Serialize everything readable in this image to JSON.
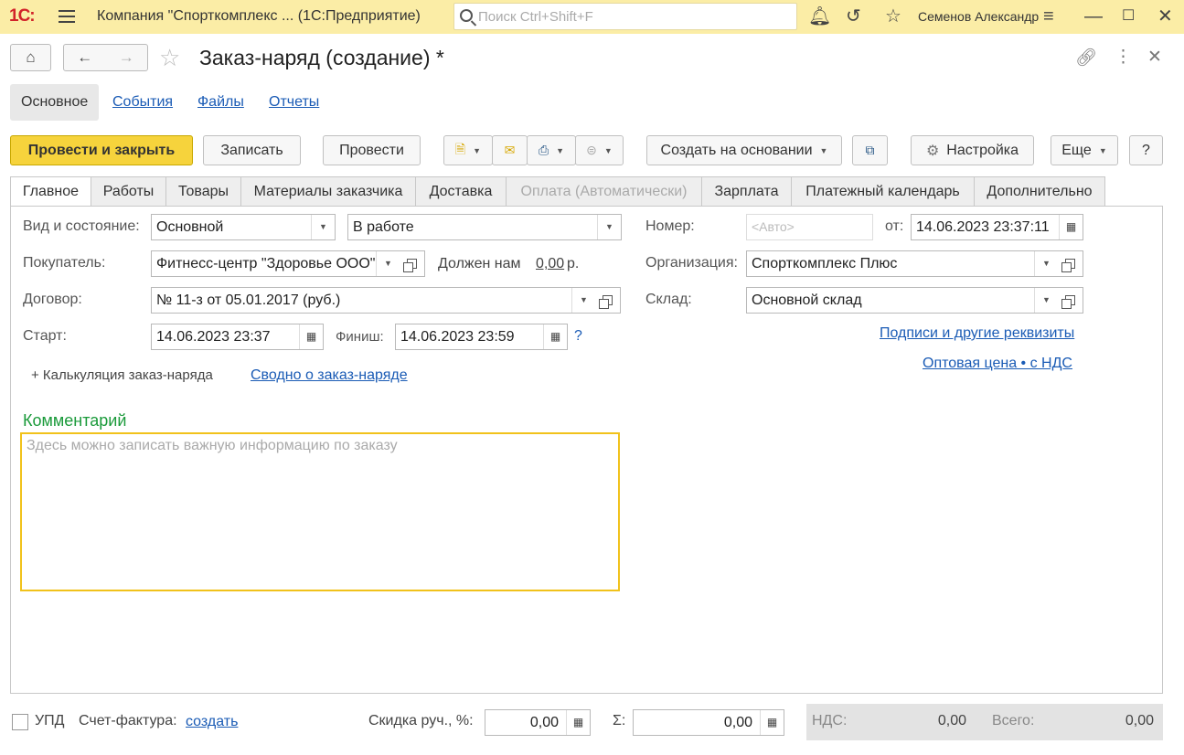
{
  "topbar": {
    "logo": "1С:",
    "app_title": "Компания \"Спорткомплекс ...   (1С:Предприятие)",
    "search_placeholder": "Поиск Ctrl+Shift+F",
    "user": "Семенов Александр"
  },
  "header": {
    "title": "Заказ-наряд (создание) *"
  },
  "nav": {
    "tabs": [
      "Основное",
      "События",
      "Файлы",
      "Отчеты"
    ]
  },
  "toolbar": {
    "post_close": "Провести и закрыть",
    "save": "Записать",
    "post": "Провести",
    "create_based": "Создать на основании",
    "settings": "Настройка",
    "more": "Еще",
    "help": "?"
  },
  "tabs": [
    "Главное",
    "Работы",
    "Товары",
    "Материалы заказчика",
    "Доставка",
    "Оплата (Автоматически)",
    "Зарплата",
    "Платежный календарь",
    "Дополнительно"
  ],
  "form": {
    "kind_label": "Вид и состояние:",
    "kind_value": "Основной",
    "state_value": "В работе",
    "buyer_label": "Покупатель:",
    "buyer_value": "Фитнесс-центр \"Здоровье ООО\"",
    "owes_label": "Должен нам",
    "owes_value": "0,00",
    "owes_unit": "р.",
    "contract_label": "Договор:",
    "contract_value": "№ 11-з от 05.01.2017 (руб.)",
    "start_label": "Старт:",
    "start_value": "14.06.2023 23:37",
    "finish_label": "Финиш:",
    "finish_value": "14.06.2023 23:59",
    "help_q": "?",
    "calc_label": "+ Калькуляция заказ-наряда",
    "summary_link": "Сводно о заказ-наряде",
    "number_label": "Номер:",
    "number_placeholder": "<Авто>",
    "date_label": "от:",
    "date_value": "14.06.2023 23:37:11",
    "org_label": "Организация:",
    "org_value": "Спорткомплекс Плюс",
    "warehouse_label": "Склад:",
    "warehouse_value": "Основной склад",
    "signatures_link": "Подписи и другие реквизиты",
    "price_link": "Оптовая цена • с НДС",
    "comment_title": "Комментарий",
    "comment_placeholder": "Здесь можно записать важную информацию по заказу"
  },
  "footer": {
    "upd_label": "УПД",
    "invoice_label": "Счет-фактура:",
    "invoice_link": "создать",
    "discount_label": "Скидка руч., %:",
    "discount_value": "0,00",
    "sum_label": "Σ:",
    "sum_value": "0,00",
    "vat_label": "НДС:",
    "vat_value": "0,00",
    "total_label": "Всего:",
    "total_value": "0,00"
  }
}
